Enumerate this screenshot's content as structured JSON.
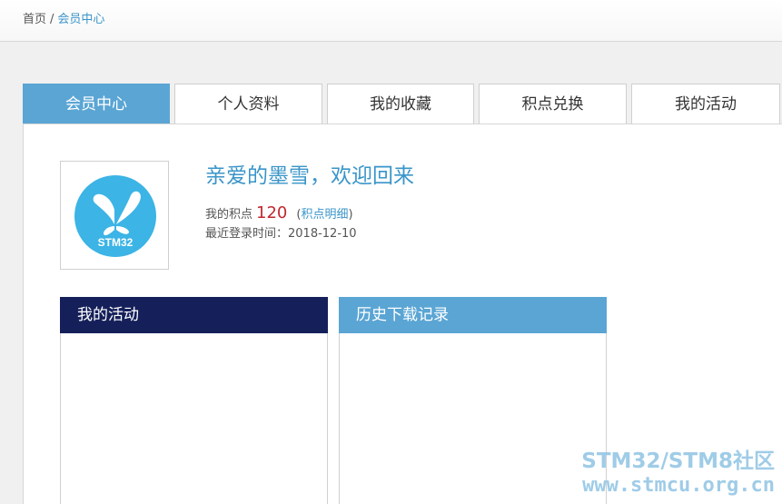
{
  "breadcrumb": {
    "home": "首页",
    "separator": "/",
    "current": "会员中心"
  },
  "tabs": [
    {
      "label": "会员中心",
      "active": true
    },
    {
      "label": "个人资料",
      "active": false
    },
    {
      "label": "我的收藏",
      "active": false
    },
    {
      "label": "积点兑换",
      "active": false
    },
    {
      "label": "我的活动",
      "active": false
    }
  ],
  "profile": {
    "avatar_text": "STM32",
    "welcome": "亲爱的墨雪，欢迎回来",
    "points_label": "我的积点",
    "points_value": "120",
    "points_paren_open": "(",
    "points_detail_link": "积点明细",
    "points_paren_close": ")",
    "last_login": "最近登录时间：2018-12-10"
  },
  "sections": {
    "activity_title": "我的活动",
    "downloads_title": "历史下载记录"
  },
  "watermark": {
    "line1": "STM32/STM8社区",
    "line2": "www.stmcu.org.cn"
  },
  "colors": {
    "accent": "#5aa5d4",
    "navy": "#15205a",
    "link": "#3a95c9",
    "points": "#c0282d"
  }
}
